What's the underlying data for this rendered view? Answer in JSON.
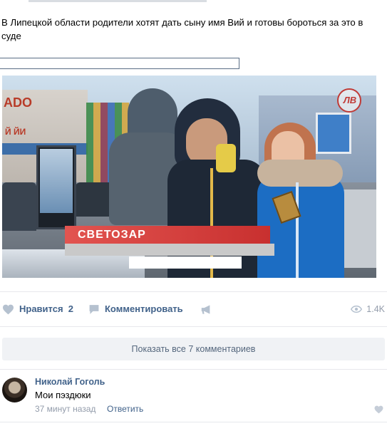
{
  "post": {
    "text": "В Липецкой области родители хотят дать сыну имя Вий и готовы бороться за это в суде"
  },
  "photo": {
    "logo_text": "ЛВ",
    "caption": "СВЕТОЗАР",
    "mall_sign_left": "ADO",
    "mall_sign_left_2": "Й ЙИ"
  },
  "actions": {
    "like_label": "Нравится",
    "like_count": "2",
    "comment_label": "Комментировать",
    "views": "1.4K"
  },
  "show_all_comments": "Показать все 7 комментариев",
  "comments": [
    {
      "author": "Николай Гоголь",
      "text": "Мои пэздюки",
      "time": "37 минут назад",
      "reply_label": "Ответить"
    }
  ],
  "colors": {
    "link": "#41628a",
    "muted": "#939cab",
    "caption_red": "#d63f3c",
    "button_bg": "#f0f2f5"
  }
}
